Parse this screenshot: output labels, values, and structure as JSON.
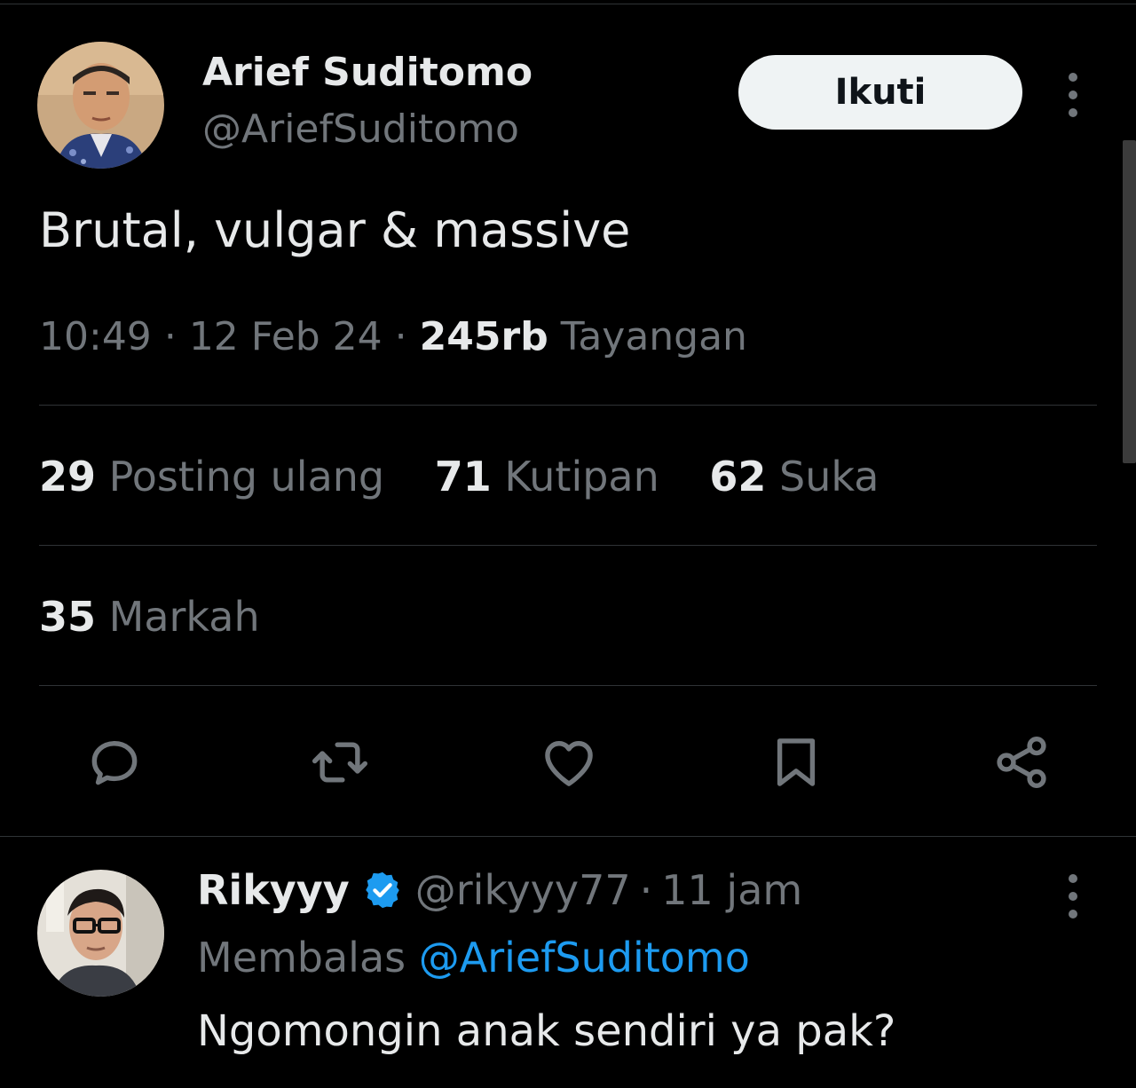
{
  "tweet": {
    "author_name": "Arief Suditomo",
    "author_handle": "@AriefSuditomo",
    "follow_label": "Ikuti",
    "text": "Brutal, vulgar & massive",
    "time": "10:49",
    "separator": "·",
    "date": "12 Feb 24",
    "views_count": "245rb",
    "views_label": "Tayangan",
    "stats": {
      "reposts_count": "29",
      "reposts_label": "Posting ulang",
      "quotes_count": "71",
      "quotes_label": "Kutipan",
      "likes_count": "62",
      "likes_label": "Suka",
      "bookmarks_count": "35",
      "bookmarks_label": "Markah"
    },
    "actions": [
      "reply-icon",
      "retweet-icon",
      "heart-icon",
      "bookmark-icon",
      "share-icon"
    ]
  },
  "reply": {
    "author_name": "Rikyyy",
    "author_handle": "@rikyyy77",
    "separator": "·",
    "time": "11 jam",
    "replying_label": "Membalas",
    "replying_to": "@AriefSuditomo",
    "text": "Ngomongin anak sendiri ya pak?"
  },
  "colors": {
    "background": "#000000",
    "text_primary": "#e7e9ea",
    "text_secondary": "#71767b",
    "accent": "#1d9bf0",
    "divider": "#2f3336"
  }
}
